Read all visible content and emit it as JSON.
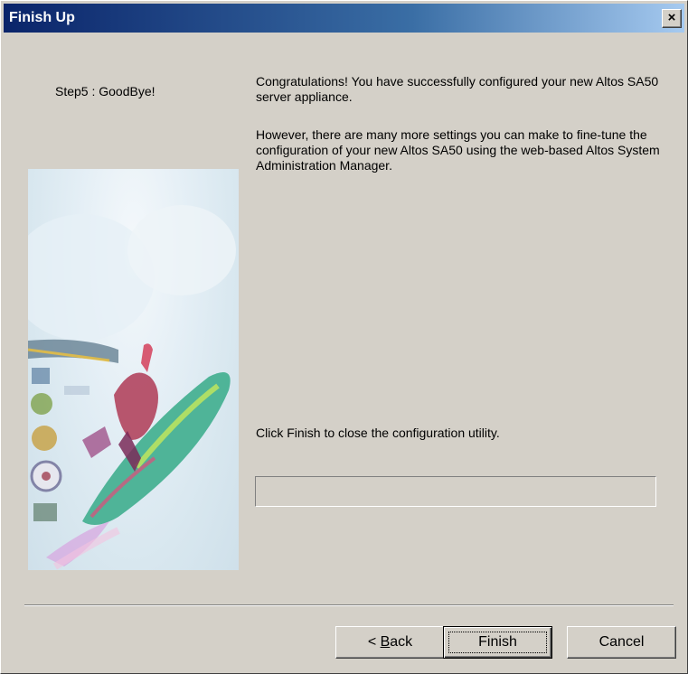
{
  "window": {
    "title": "Finish Up",
    "close_glyph": "×"
  },
  "sidebar": {
    "step_label": "Step5 : GoodBye!"
  },
  "content": {
    "paragraph1": "Congratulations! You have successfully configured your new Altos SA50 server appliance.",
    "paragraph2": "However, there are many more settings you can make to fine-tune the configuration of your new Altos SA50 using the web-based Altos System Administration Manager.",
    "paragraph3": "Click Finish to close the configuration utility."
  },
  "progress": {
    "value": 0
  },
  "buttons": {
    "back_prefix": "< ",
    "back_accel": "B",
    "back_rest": "ack",
    "finish": "Finish",
    "cancel": "Cancel"
  },
  "colors": {
    "titlebar_start": "#0a246a",
    "titlebar_end": "#a6caf0",
    "face": "#d4d0c8"
  }
}
